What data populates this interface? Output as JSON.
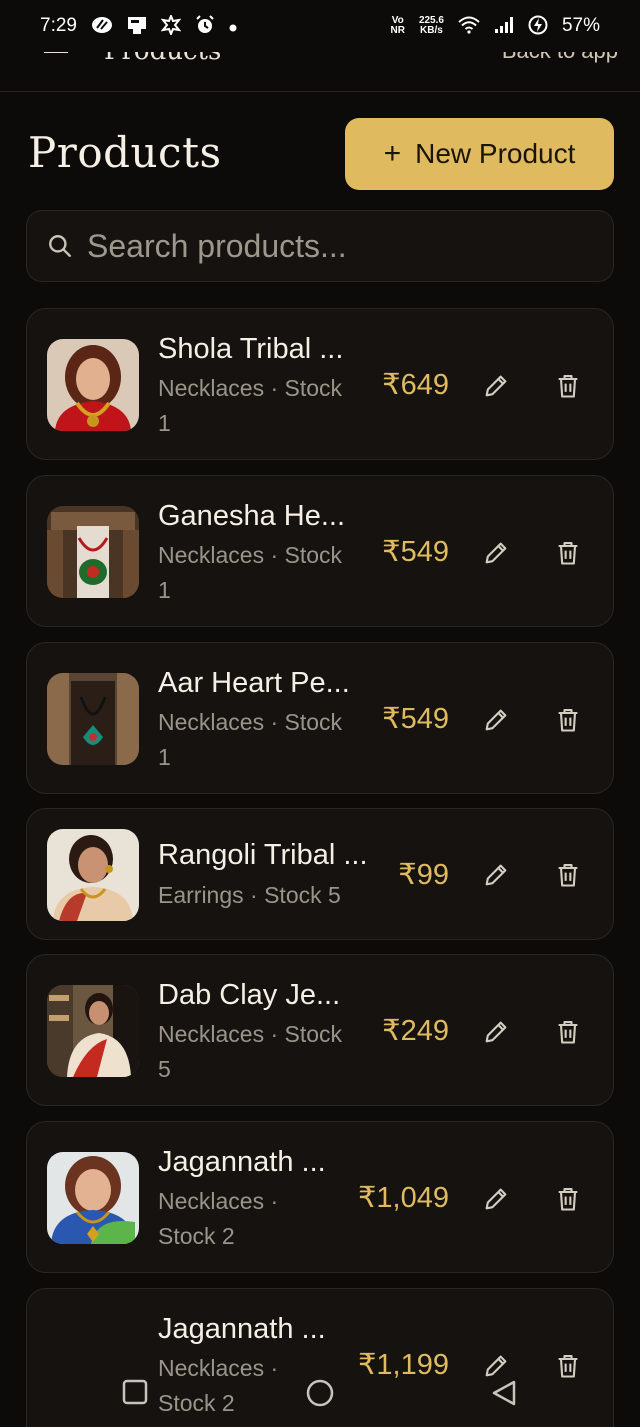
{
  "status_bar": {
    "time": "7:29",
    "network_speed": "225.6",
    "network_unit": "KB/s",
    "volte": "Vo",
    "volte_sub": "NR",
    "battery": "57%"
  },
  "app_bar": {
    "title": "Products",
    "back_label": "Back to app"
  },
  "header": {
    "title": "Products",
    "new_button_label": "New Product",
    "new_button_icon": "plus-icon"
  },
  "search": {
    "placeholder": "Search products...",
    "value": ""
  },
  "colors": {
    "background": "#0d0b09",
    "card": "#15120f",
    "accent": "#dfba5e",
    "muted": "#9a948a"
  },
  "products": [
    {
      "name": "Shola Tribal ...",
      "meta_line1": "Necklaces · Stock",
      "meta_line2": "1",
      "price": "₹649"
    },
    {
      "name": "Ganesha He...",
      "meta_line1": "Necklaces · Stock",
      "meta_line2": "1",
      "price": "₹549"
    },
    {
      "name": "Aar Heart Pe...",
      "meta_line1": "Necklaces · Stock",
      "meta_line2": "1",
      "price": "₹549"
    },
    {
      "name": "Rangoli Tribal ...",
      "meta_line1": "Earrings · Stock 5",
      "meta_line2": "",
      "price": "₹99"
    },
    {
      "name": "Dab Clay Je...",
      "meta_line1": "Necklaces · Stock",
      "meta_line2": "5",
      "price": "₹249"
    },
    {
      "name": "Jagannath ...",
      "meta_line1": "Necklaces ·",
      "meta_line2": "Stock 2",
      "price": "₹1,049"
    },
    {
      "name": "Jagannath ...",
      "meta_line1": "Necklaces ·",
      "meta_line2": "Stock 2",
      "price": "₹1,199"
    }
  ],
  "nav_bar": {
    "recents_icon": "square-icon",
    "home_icon": "circle-icon",
    "back_icon": "triangle-back-icon"
  }
}
